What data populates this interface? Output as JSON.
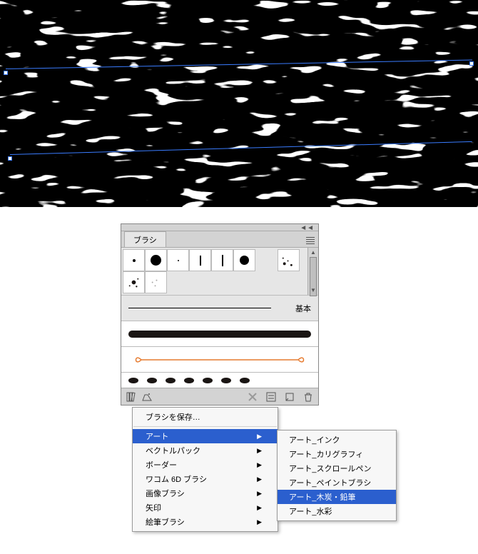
{
  "panel": {
    "tab_label": "ブラシ",
    "basic_label": "基本"
  },
  "swatches": [
    {
      "name": "dot-s",
      "r": 2
    },
    {
      "name": "dot-l",
      "r": 7
    },
    {
      "name": "dot-t",
      "r": 1
    },
    {
      "name": "stroke-v",
      "r": 0
    },
    {
      "name": "stroke-v2",
      "r": 0
    },
    {
      "name": "disc",
      "r": 6
    },
    {
      "name": "spacer",
      "r": 0
    },
    {
      "name": "splat1",
      "r": 0
    },
    {
      "name": "splat2",
      "r": 0
    },
    {
      "name": "splat3",
      "r": 0
    }
  ],
  "footer_icons": {
    "library": "library-icon",
    "swatch": "swatch-library-icon",
    "remove": "remove-stroke-icon",
    "options": "stroke-options-icon",
    "new": "new-brush-icon",
    "delete": "delete-brush-icon"
  },
  "ctx": {
    "save": "ブラシを保存…",
    "items": [
      {
        "label": "アート",
        "highlight": true
      },
      {
        "label": "ベクトルパック"
      },
      {
        "label": "ボーダー"
      },
      {
        "label": "ワコム 6D ブラシ"
      },
      {
        "label": "画像ブラシ"
      },
      {
        "label": "矢印"
      },
      {
        "label": "絵筆ブラシ"
      }
    ]
  },
  "sub": {
    "items": [
      {
        "label": "アート_インク"
      },
      {
        "label": "アート_カリグラフィ"
      },
      {
        "label": "アート_スクロールペン"
      },
      {
        "label": "アート_ペイントブラシ"
      },
      {
        "label": "アート_木炭・鉛筆",
        "highlight": true
      },
      {
        "label": "アート_水彩"
      }
    ]
  }
}
